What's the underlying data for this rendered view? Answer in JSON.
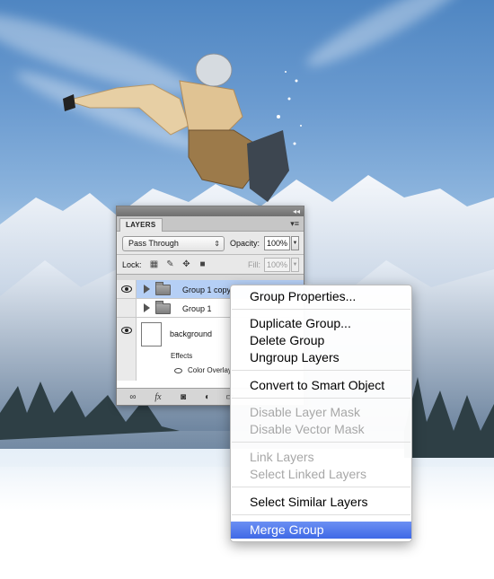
{
  "layers_panel": {
    "tab_label": "LAYERS",
    "blend_mode": "Pass Through",
    "opacity_label": "Opacity:",
    "opacity_value": "100%",
    "lock_label": "Lock:",
    "fill_label": "Fill:",
    "fill_value": "100%",
    "layers": [
      {
        "name": "Group 1 copy",
        "visible": true,
        "selected": true,
        "type": "group"
      },
      {
        "name": "Group 1",
        "visible": false,
        "selected": false,
        "type": "group"
      },
      {
        "name": "background",
        "visible": true,
        "selected": false,
        "type": "layer",
        "effects_label": "Effects",
        "effect": "Color Overlay"
      }
    ],
    "footer_icons": [
      "link-icon",
      "fx-icon",
      "mask-icon",
      "adjustment-icon",
      "folder-icon"
    ]
  },
  "context_menu": {
    "items": [
      {
        "label": "Group Properties...",
        "enabled": true
      },
      {
        "label": "Duplicate Group...",
        "enabled": true
      },
      {
        "label": "Delete Group",
        "enabled": true
      },
      {
        "label": "Ungroup Layers",
        "enabled": true
      },
      {
        "label": "Convert to Smart Object",
        "enabled": true
      },
      {
        "label": "Disable Layer Mask",
        "enabled": false
      },
      {
        "label": "Disable Vector Mask",
        "enabled": false
      },
      {
        "label": "Link Layers",
        "enabled": false
      },
      {
        "label": "Select Linked Layers",
        "enabled": false
      },
      {
        "label": "Select Similar Layers",
        "enabled": true
      },
      {
        "label": "Merge Group",
        "enabled": true,
        "highlighted": true
      }
    ]
  },
  "colors": {
    "menu_highlight": "#4a73eb",
    "selected_layer": "#b5cff5",
    "panel_bg": "#d9d9d9"
  }
}
